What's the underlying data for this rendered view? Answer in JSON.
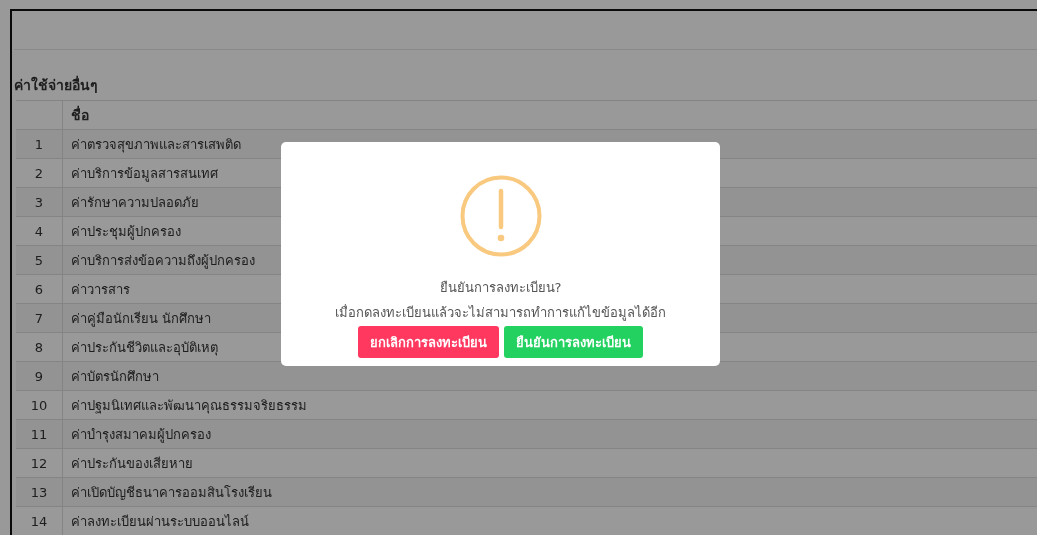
{
  "section_title": "ค่าใช้จ่ายอื่นๆ",
  "table": {
    "columns": [
      "ชื่อ"
    ],
    "rows": [
      {
        "no": "1",
        "name": "ค่าตรวจสุขภาพและสารเสพติด"
      },
      {
        "no": "2",
        "name": "ค่าบริการข้อมูลสารสนเทศ"
      },
      {
        "no": "3",
        "name": "ค่ารักษาความปลอดภัย"
      },
      {
        "no": "4",
        "name": "ค่าประชุมผู้ปกครอง"
      },
      {
        "no": "5",
        "name": "ค่าบริการส่งข้อความถึงผู้ปกครอง"
      },
      {
        "no": "6",
        "name": "ค่าวารสาร"
      },
      {
        "no": "7",
        "name": "ค่าคู่มือนักเรียน นักศึกษา"
      },
      {
        "no": "8",
        "name": "ค่าประกันชีวิตและอุบัติเหตุ"
      },
      {
        "no": "9",
        "name": "ค่าบัตรนักศึกษา"
      },
      {
        "no": "10",
        "name": "ค่าปฐมนิเทศและพัฒนาคุณธรรมจริยธรรม"
      },
      {
        "no": "11",
        "name": "ค่าบำรุงสมาคมผู้ปกครอง"
      },
      {
        "no": "12",
        "name": "ค่าประกันของเสียหาย"
      },
      {
        "no": "13",
        "name": "ค่าเปิดบัญชีธนาคารออมสินโรงเรียน"
      },
      {
        "no": "14",
        "name": "ค่าลงทะเบียนผ่านระบบออนไลน์"
      }
    ]
  },
  "dialog": {
    "title": "ยืนยันการลงทะเบียน?",
    "message": "เมื่อกดลงทะเบียนแล้วจะไม่สามารถทำการแก้ไขข้อมูลได้อีก",
    "buttons": [
      {
        "kind": "cancel",
        "label": "ยกเลิกการลงทะเบียน"
      },
      {
        "kind": "confirm",
        "label": "ยืนยันการลงทะเบียน"
      }
    ]
  }
}
